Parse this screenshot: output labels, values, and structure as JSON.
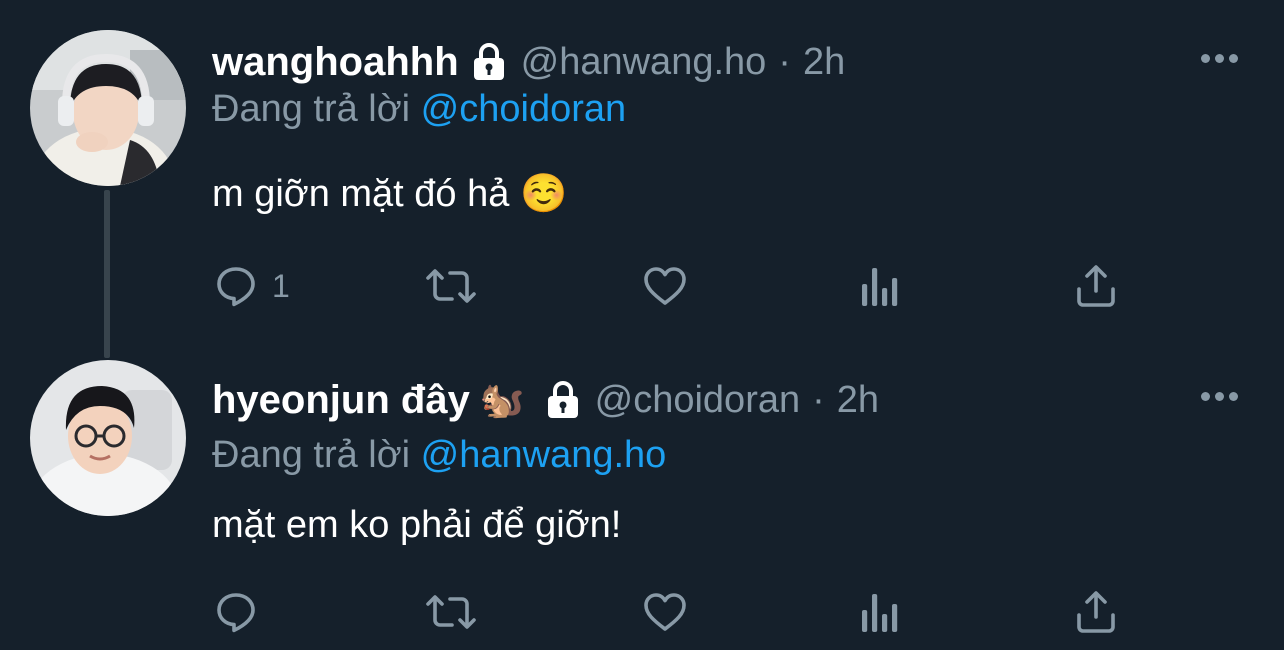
{
  "tweets": [
    {
      "display_name": "wanghoahhh",
      "emoji": "",
      "handle": "@hanwang.ho",
      "separator": "·",
      "time": "2h",
      "reply_prefix": "Đang trả lời",
      "reply_to": "@choidoran",
      "text": "m giỡn mặt đó hả ☺️",
      "reply_count": "1",
      "avatar_icon": "person-headphones-avatar"
    },
    {
      "display_name": "hyeonjun đây",
      "emoji": "🐿️",
      "handle": "@choidoran",
      "separator": "·",
      "time": "2h",
      "reply_prefix": "Đang trả lời",
      "reply_to": "@hanwang.ho",
      "text": "mặt em ko phải để giỡn!",
      "reply_count": "",
      "avatar_icon": "person-glasses-avatar"
    }
  ],
  "colors": {
    "background": "#15202b",
    "secondary_text": "#8899a6",
    "link": "#1da1f2",
    "divider": "#38444d"
  },
  "icons": [
    "lock-icon",
    "more-icon",
    "reply-icon",
    "retweet-icon",
    "like-icon",
    "analytics-icon",
    "share-icon"
  ]
}
